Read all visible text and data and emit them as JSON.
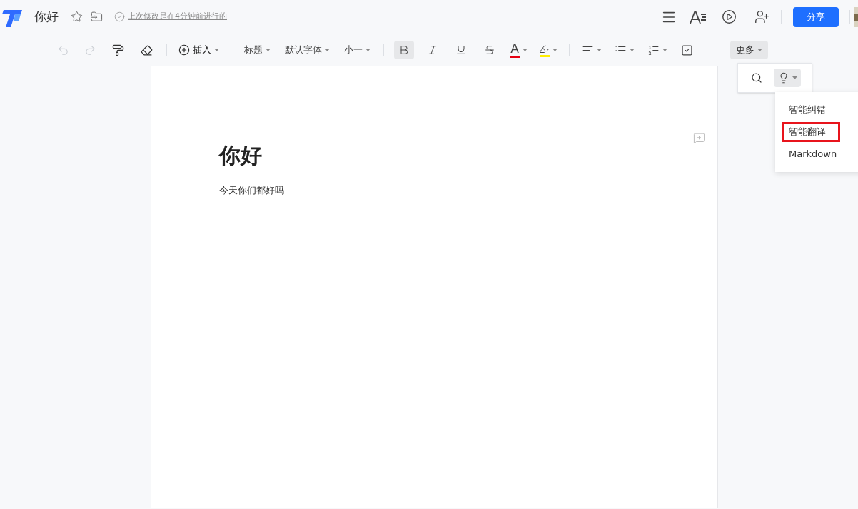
{
  "header": {
    "title": "你好",
    "save_status": "上次修改是在4分钟前进行的",
    "share_button": "分享"
  },
  "toolbar": [
    {
      "kind": "undo",
      "disabled": true
    },
    {
      "kind": "redo",
      "disabled": true
    },
    {
      "kind": "painter"
    },
    {
      "kind": "eraser"
    },
    {
      "kind": "sep"
    },
    {
      "kind": "insert",
      "label": "插入"
    },
    {
      "kind": "sep"
    },
    {
      "kind": "dropdown",
      "label": "标题"
    },
    {
      "kind": "dropdown",
      "label": "默认字体"
    },
    {
      "kind": "dropdown",
      "label": "小一"
    },
    {
      "kind": "sep"
    },
    {
      "kind": "bold",
      "selected": true
    },
    {
      "kind": "italic",
      "selected": false
    },
    {
      "kind": "underline",
      "selected": false
    },
    {
      "kind": "strike",
      "selected": false
    },
    {
      "kind": "fontcolor",
      "label": "A",
      "color": "#e60012"
    },
    {
      "kind": "highlight",
      "color": "#ffee00"
    },
    {
      "kind": "sep"
    },
    {
      "kind": "align"
    },
    {
      "kind": "bullets"
    },
    {
      "kind": "numbers"
    },
    {
      "kind": "todo"
    },
    {
      "kind": "more",
      "label": "更多",
      "selected": true
    }
  ],
  "document": {
    "heading": "你好",
    "paragraph": "今天你们都好吗"
  },
  "more_popover": {
    "menu": [
      {
        "label": "智能纠错",
        "highlighted": false
      },
      {
        "label": "智能翻译",
        "highlighted": true
      },
      {
        "label": "Markdown",
        "highlighted": false
      }
    ]
  }
}
